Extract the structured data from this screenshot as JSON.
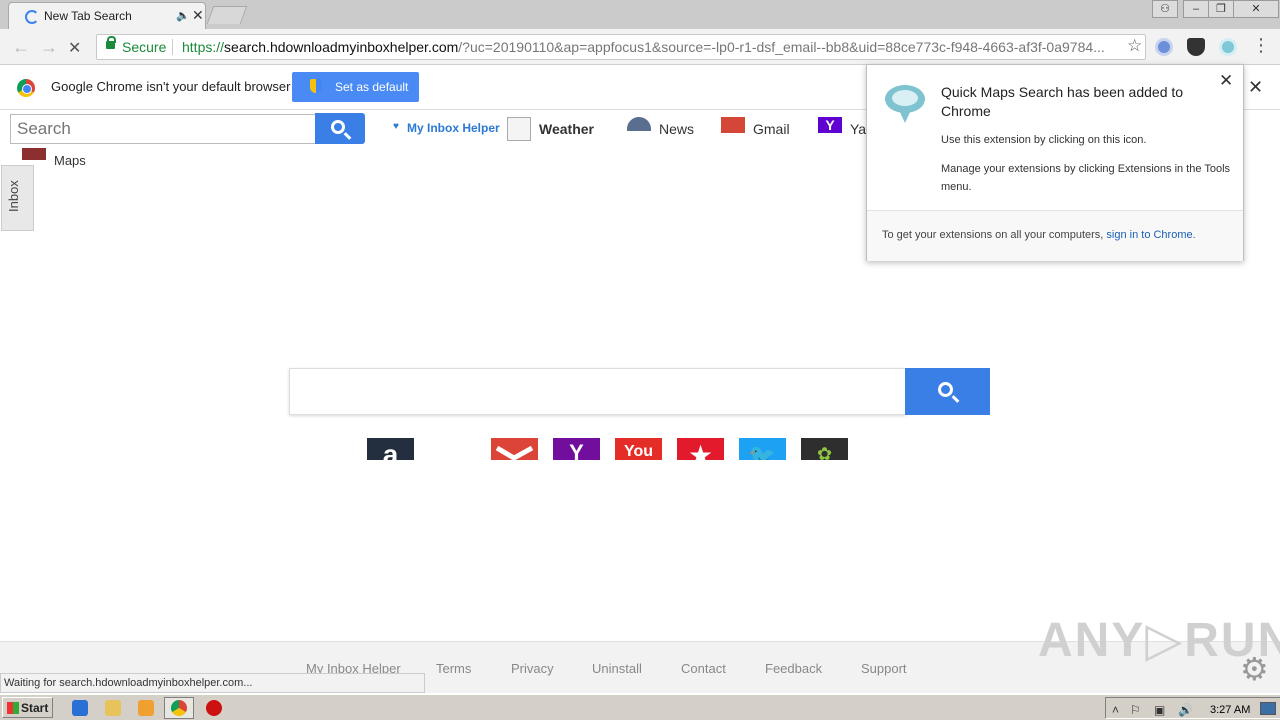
{
  "browser": {
    "tab": {
      "title": "New Tab Search",
      "audio_icon": "speaker-icon",
      "close_glyph": "✕"
    },
    "window_controls": {
      "user": "👤",
      "minimize": "–",
      "restore": "❐",
      "close": "✕"
    },
    "address": {
      "secure_label": "Secure",
      "url_scheme": "https://",
      "url_host": "search.hdownloadmyinboxhelper.com",
      "url_rest": "/?uc=20190110&ap=appfocus1&source=-lp0-r1-dsf_email--bb8&uid=88ce773c-f948-4663-af3f-0a9784..."
    },
    "nav": {
      "back": "←",
      "forward": "→",
      "reload": "✕"
    }
  },
  "infobar": {
    "message": "Google Chrome isn't your default browser",
    "button_label": "Set as default",
    "close_glyph": "✕"
  },
  "page": {
    "search_placeholder": "Search",
    "nav_links": {
      "my_inbox_helper": "My Inbox Helper",
      "weather": "Weather",
      "news": "News",
      "gmail": "Gmail",
      "yahoo": "Ya"
    },
    "maps_label": "Maps",
    "inbox_tab": "Inbox",
    "quick_links": {
      "amazon": "a",
      "yahoo": "Y",
      "youtube": "You",
      "macys": "★",
      "leaf": "✿"
    }
  },
  "popup": {
    "title": "Quick Maps Search has been added to Chrome",
    "line1": "Use this extension by clicking on this icon.",
    "line2": "Manage your extensions by clicking Extensions in the Tools menu.",
    "footer_text": "To get your extensions on all your computers,",
    "footer_link": "sign in to Chrome.",
    "close_glyph": "✕"
  },
  "footer": {
    "links": [
      "My Inbox Helper",
      "Terms",
      "Privacy",
      "Uninstall",
      "Contact",
      "Feedback",
      "Support"
    ],
    "status": "Waiting for search.hdownloadmyinboxhelper.com...",
    "watermark": "ANY▷RUN"
  },
  "taskbar": {
    "start_label": "Start",
    "clock": "3:27 AM"
  },
  "colors": {
    "accent_blue": "#3a7fe6",
    "secure_green": "#1b8a3a",
    "link_blue": "#1a5fb4"
  }
}
